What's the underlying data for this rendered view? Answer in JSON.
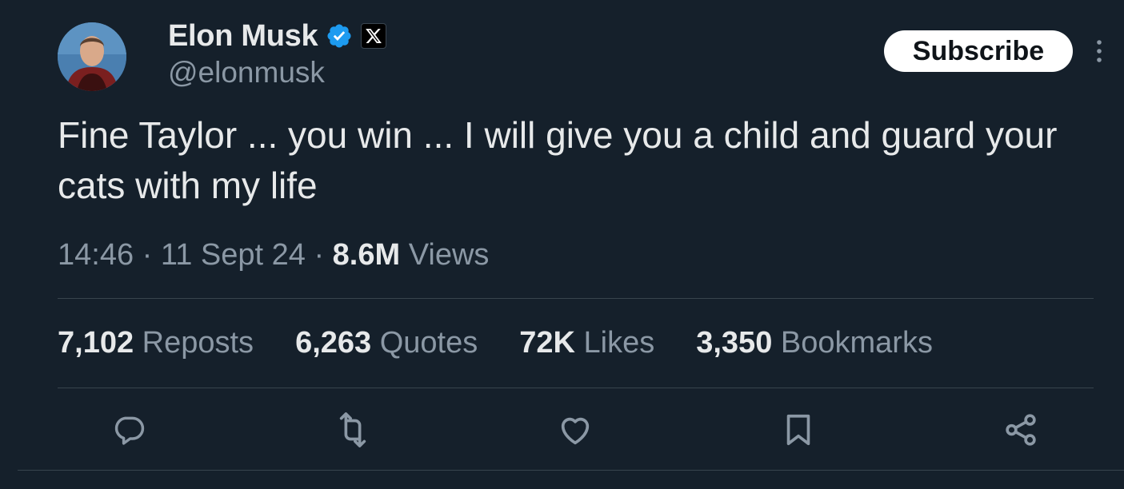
{
  "author": {
    "name": "Elon Musk",
    "handle": "@elonmusk",
    "verified_icon": "verified-badge-icon",
    "affiliate_icon": "x-logo-icon"
  },
  "header": {
    "subscribe_label": "Subscribe",
    "more_icon": "more-vertical-icon"
  },
  "tweet": {
    "text": "Fine Taylor ... you win ... I will give you a child and guard your cats with my life",
    "time": "14:46",
    "separator1": " · ",
    "date": "11 Sept 24",
    "separator2": " · ",
    "views_count": "8.6M",
    "views_label": " Views"
  },
  "stats": [
    {
      "num": "7,102",
      "label": " Reposts"
    },
    {
      "num": "6,263",
      "label": " Quotes"
    },
    {
      "num": "72K",
      "label": " Likes"
    },
    {
      "num": "3,350",
      "label": " Bookmarks"
    }
  ],
  "actions": [
    "reply-icon",
    "repost-icon",
    "like-icon",
    "bookmark-icon",
    "share-icon"
  ],
  "colors": {
    "background": "#15202b",
    "text_primary": "#e7e9ea",
    "text_secondary": "#8b98a5",
    "verified_blue": "#1d9bf0",
    "divider": "#38444d"
  }
}
